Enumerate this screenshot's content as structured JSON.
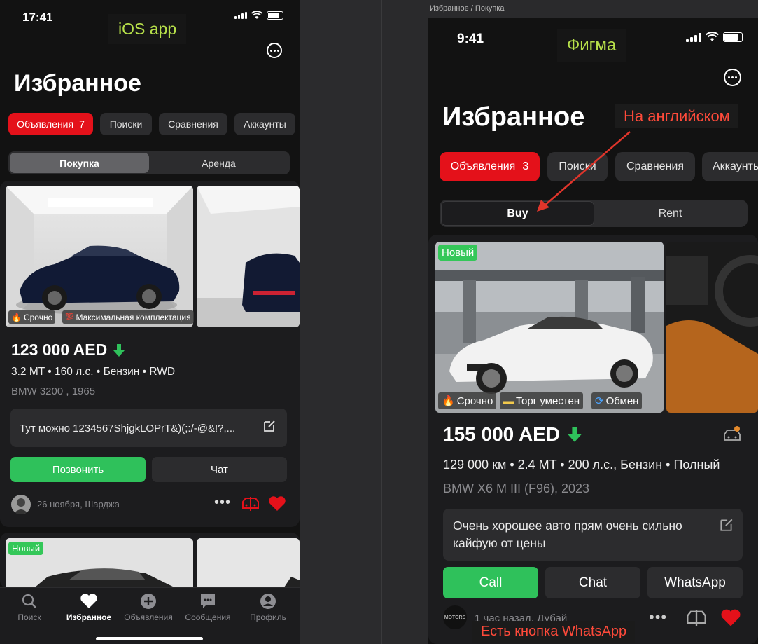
{
  "left": {
    "label": "iOS app",
    "status_time": "17:41",
    "title": "Избранное",
    "tabs": [
      {
        "label": "Объявления",
        "count": "7"
      },
      {
        "label": "Поиски"
      },
      {
        "label": "Сравнения"
      },
      {
        "label": "Аккаунты"
      }
    ],
    "segment": [
      "Покупка",
      "Аренда"
    ],
    "card": {
      "badges": [
        "Срочно",
        "Максимальная комплектация"
      ],
      "price": "123 000 AED",
      "specs": "3.2 MT • 160 л.с. • Бензин • RWD",
      "model": "BMW 3200 , 1965",
      "note": "Тут можно 1234567ShjgkLOPrT&)(;:/-@&!?,...",
      "call": "Позвонить",
      "chat": "Чат",
      "meta": "26 ноября, Шарджа"
    },
    "second_card_badge": "Новый",
    "tabbar": [
      "Поиск",
      "Избранное",
      "Объявления",
      "Сообщения",
      "Профиль"
    ]
  },
  "right": {
    "breadcrumb": "Избранное / Покупка",
    "label": "Фигма",
    "annotation_top": "На английском",
    "annotation_bottom": "Есть кнопка WhatsApp",
    "status_time": "9:41",
    "title": "Избранное",
    "tabs": [
      {
        "label": "Объявления",
        "count": "3"
      },
      {
        "label": "Поиски"
      },
      {
        "label": "Сравнения"
      },
      {
        "label": "Аккаунты"
      }
    ],
    "segment": [
      "Buy",
      "Rent"
    ],
    "card": {
      "new_badge": "Новый",
      "badges": [
        "Срочно",
        "Торг уместен",
        "Обмен"
      ],
      "price": "155 000 AED",
      "specs": "129 000 км • 2.4 MT • 200 л.с., Бензин • Полный",
      "model": "BMW X6 M III (F96), 2023",
      "note": "Очень хорошее авто прям очень сильно кайфую от цены",
      "call": "Call",
      "chat": "Chat",
      "whatsapp": "WhatsApp",
      "meta": "1 час назад, Дубай",
      "dealer_logo": "MOTORS"
    }
  },
  "colors": {
    "accent_red": "#e4111a",
    "accent_green": "#2fc15b",
    "annotation_red": "#e0352b"
  }
}
